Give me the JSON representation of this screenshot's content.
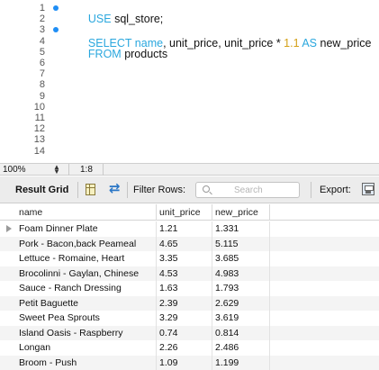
{
  "editor": {
    "line_numbers": [
      "1",
      "2",
      "3",
      "4",
      "5",
      "6",
      "7",
      "8",
      "9",
      "10",
      "11",
      "12",
      "13",
      "14"
    ],
    "breakpoint_lines": [
      1,
      3
    ],
    "code": {
      "line1": {
        "kw": "USE",
        "rest": " sql_store;"
      },
      "line3": {
        "kw1": "SELECT",
        "col": " name",
        "rest": ", unit_price, unit_price * ",
        "num": "1.1",
        "kw2": " AS",
        "alias": " new_price"
      },
      "line4": {
        "kw": "FROM",
        "rest": " products"
      }
    }
  },
  "status": {
    "zoom": "100%",
    "cursor": "1:8"
  },
  "toolbar": {
    "result_grid_label": "Result Grid",
    "filter_rows_label": "Filter Rows:",
    "search_placeholder": "Search",
    "export_label": "Export:",
    "icons": [
      "grid-icon",
      "swap-arrows-icon",
      "search-icon",
      "export-icon"
    ]
  },
  "grid": {
    "columns": [
      "name",
      "unit_price",
      "new_price"
    ],
    "rows": [
      [
        "Foam Dinner Plate",
        "1.21",
        "1.331"
      ],
      [
        "Pork - Bacon,back Peameal",
        "4.65",
        "5.115"
      ],
      [
        "Lettuce - Romaine, Heart",
        "3.35",
        "3.685"
      ],
      [
        "Brocolinni - Gaylan, Chinese",
        "4.53",
        "4.983"
      ],
      [
        "Sauce - Ranch Dressing",
        "1.63",
        "1.793"
      ],
      [
        "Petit Baguette",
        "2.39",
        "2.629"
      ],
      [
        "Sweet Pea Sprouts",
        "3.29",
        "3.619"
      ],
      [
        "Island Oasis - Raspberry",
        "0.74",
        "0.814"
      ],
      [
        "Longan",
        "2.26",
        "2.486"
      ],
      [
        "Broom - Push",
        "1.09",
        "1.199"
      ]
    ]
  },
  "colors": {
    "keyword": "#2aa7de",
    "number": "#d4a017",
    "breakpoint": "#1f8ef5",
    "toolbar_bg": "#ececec"
  }
}
